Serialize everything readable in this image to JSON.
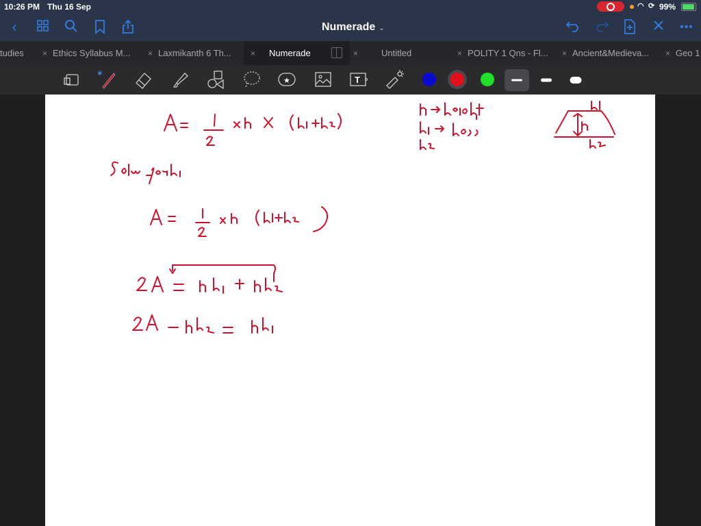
{
  "status_bar": {
    "time": "10:26 PM",
    "date": "Thu 16 Sep",
    "battery": "99%",
    "icons": [
      "screen-record-icon",
      "mic-dot-icon",
      "wifi-icon",
      "rotation-lock-icon",
      "battery-charging-icon"
    ]
  },
  "nav": {
    "title": "Numerade",
    "title_chevron": "⌄",
    "left_buttons": [
      "back-icon",
      "grid-icon",
      "search-icon",
      "bookmark-icon",
      "share-icon"
    ],
    "right_buttons": [
      "undo-icon",
      "redo-icon",
      "add-page-icon",
      "close-icon",
      "more-icon"
    ]
  },
  "tabs": [
    {
      "label": "tudies",
      "close": "",
      "active": false
    },
    {
      "label": "Ethics Syllabus M...",
      "close": "×",
      "active": false
    },
    {
      "label": "Laxmikanth 6 Th...",
      "close": "×",
      "active": false
    },
    {
      "label": "Numerade",
      "close": "×",
      "active": true
    },
    {
      "label": "Untitled",
      "close": "×",
      "active": false
    },
    {
      "label": "POLITY 1 Qns - Fl...",
      "close": "×",
      "active": false
    },
    {
      "label": "Ancient&Medieva...",
      "close": "×",
      "active": false
    },
    {
      "label": "Geo 1",
      "close": "×",
      "active": false
    }
  ],
  "toolbar": {
    "tools": [
      "zoom-window-tool",
      "pen-tool",
      "eraser-tool",
      "highlighter-tool",
      "shapes-tool",
      "lasso-tool",
      "sticker-tool",
      "image-tool",
      "text-tool",
      "laser-pointer-tool"
    ],
    "colors": [
      {
        "name": "blue",
        "hex": "#0a0ad0",
        "selected": false
      },
      {
        "name": "red",
        "hex": "#e3101c",
        "selected": true
      },
      {
        "name": "green",
        "hex": "#22e02a",
        "selected": false
      }
    ],
    "thickness": [
      {
        "name": "thin",
        "selected": true
      },
      {
        "name": "medium",
        "selected": false
      },
      {
        "name": "thick",
        "selected": false
      }
    ]
  },
  "canvas": {
    "ink_color": "#d0132c",
    "notes": [
      "A = 1/2 × h × (b1+b2)",
      "Solve for b1",
      "A = 1/2 × h (b1+b2)",
      "2A = hb1 + hb2",
      "2A − hb2 = hb1"
    ],
    "legend": [
      "h → height",
      "b1 → base",
      "b2"
    ],
    "diagram_labels": [
      "b1",
      "h",
      "b2"
    ]
  }
}
